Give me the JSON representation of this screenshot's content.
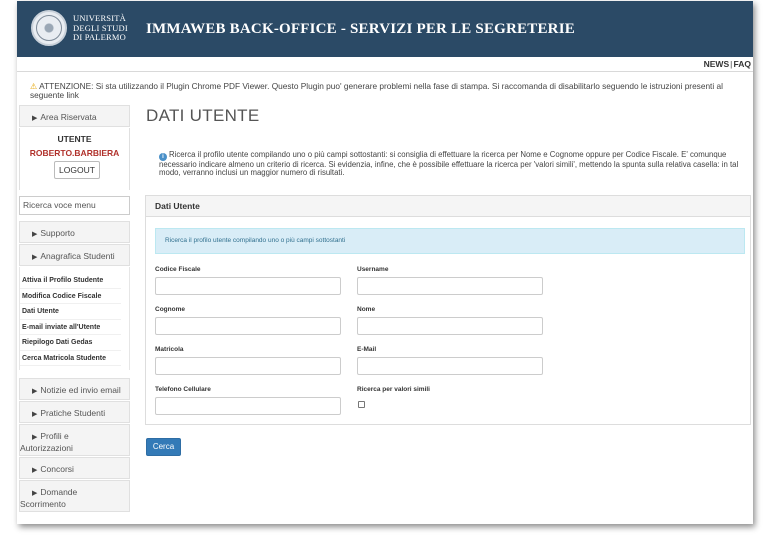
{
  "header": {
    "university_lines": [
      "UNIVERSITÀ",
      "DEGLI STUDI",
      "DI PALERMO"
    ],
    "app_title": "IMMAWEB BACK-OFFICE - SERVIZI PER LE SEGRETERIE",
    "links": [
      "NEWS",
      "FAQ"
    ],
    "bg_color": "#2b4a66"
  },
  "warning": {
    "text": "ATTENZIONE: Si sta utilizzando il Plugin Chrome PDF Viewer. Questo Plugin puo' generare problemi nella fase di stampa. Si raccomanda di disabilitarlo seguendo le istruzioni presenti al seguente link"
  },
  "sidebar": {
    "area_riservata": "Area Riservata",
    "user_label": "UTENTE",
    "user_name": "ROBERTO.BARBIERA",
    "logout_label": "LOGOUT",
    "search_placeholder": "Ricerca voce menu",
    "supporto": "Supporto",
    "anagrafica": "Anagrafica Studenti",
    "sub_items": [
      "Attiva il Profilo Studente",
      "Modifica Codice Fiscale",
      "Dati Utente",
      "E-mail inviate all'Utente",
      "Riepilogo Dati Gedas",
      "Cerca Matricola Studente"
    ],
    "notizie": "Notizie ed invio email",
    "pratiche": "Pratiche Studenti",
    "profili": [
      "Profili e",
      "Autorizzazioni"
    ],
    "concorsi": "Concorsi",
    "domande": [
      "Domande",
      "Scorrimento"
    ]
  },
  "main": {
    "page_title": "DATI UTENTE",
    "info_text": "Ricerca il profilo utente compilando uno o più campi sottostanti: si consiglia di effettuare la ricerca per Nome e Cognome oppure per Codice Fiscale. E' comunque necessario indicare almeno un criterio di ricerca. Si evidenzia, infine, che è possibile effettuare la ricerca per 'valori simili', mettendo la spunta sulla relativa casella: in tal modo, verranno inclusi un maggior numero di risultati.",
    "panel_title": "Dati Utente",
    "panel_alert": "Ricerca il profilo utente compilando uno o più campi sottostanti",
    "fields": {
      "codice_fiscale": "Codice Fiscale",
      "username": "Username",
      "cognome": "Cognome",
      "nome": "Nome",
      "matricola": "Matricola",
      "email": "E-Mail",
      "telefono": "Telefono Cellulare",
      "valori_simili": "Ricerca per valori simili"
    },
    "search_button": "Cerca",
    "accent_color": "#337ab7"
  }
}
